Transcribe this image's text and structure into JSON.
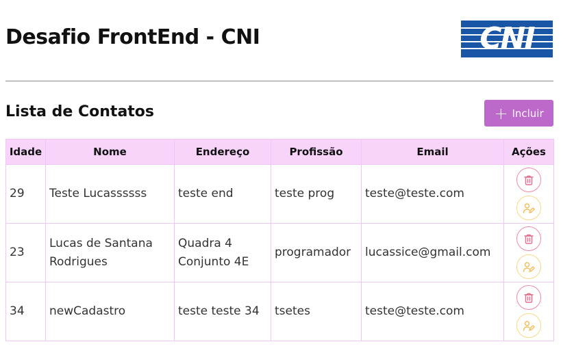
{
  "header": {
    "title": "Desafio FrontEnd - CNI",
    "logo_text": "CNI"
  },
  "contacts": {
    "title": "Lista de Contatos",
    "add_button_label": "Incluir"
  },
  "table": {
    "columns": [
      "Idade",
      "Nome",
      "Endereço",
      "Profissão",
      "Email",
      "Ações"
    ],
    "rows": [
      {
        "idade": "29",
        "nome": "Teste Lucassssss",
        "endereco": "teste end",
        "profissao": "teste prog",
        "email": "teste@teste.com"
      },
      {
        "idade": "23",
        "nome": "Lucas de Santana Rodrigues",
        "endereco": "Quadra 4 Conjunto 4E",
        "profissao": "programador",
        "email": "lucassice@gmail.com"
      },
      {
        "idade": "34",
        "nome": "newCadastro",
        "endereco": "teste teste 34",
        "profissao": "tsetes",
        "email": "teste@teste.com"
      }
    ]
  },
  "colors": {
    "accent": "#bd69cc",
    "header_bg": "#f8d4fb",
    "delete": "#e0728f",
    "edit": "#f0c060",
    "logo_bg": "#1a56a6"
  },
  "icons": {
    "add": "plus-icon",
    "delete": "trash-icon",
    "edit": "user-edit-icon"
  }
}
